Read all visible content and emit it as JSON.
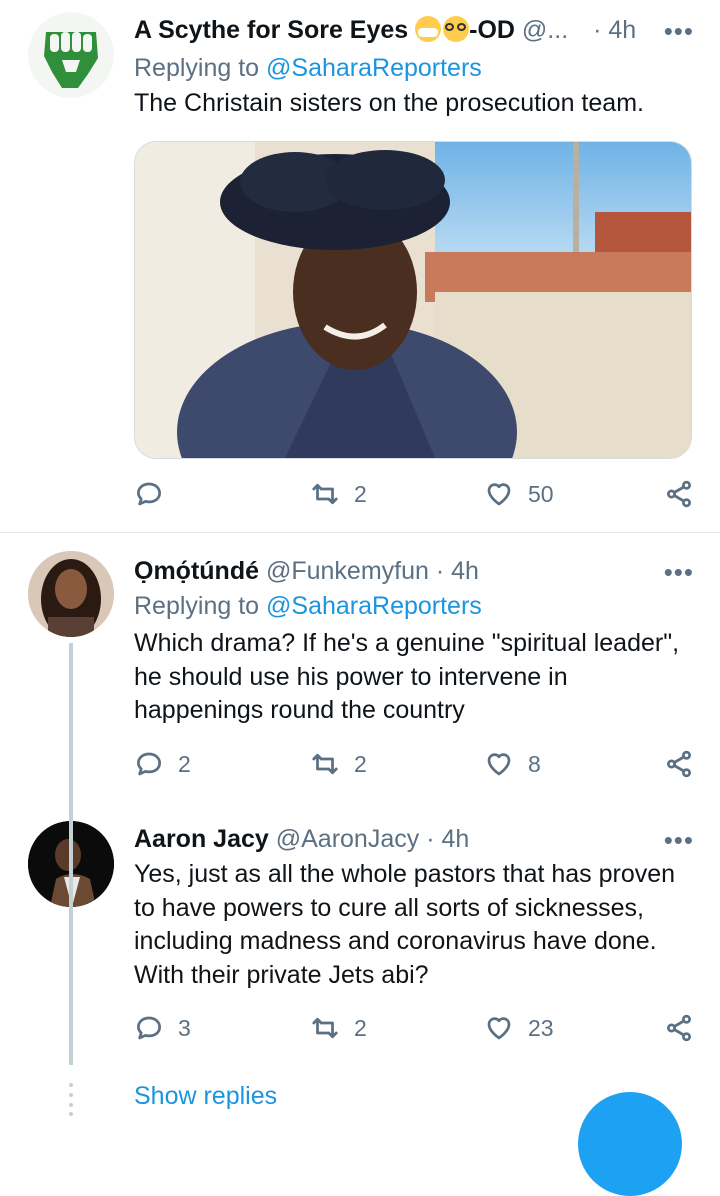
{
  "tweets": [
    {
      "name": "A Scythe for Sore Eyes",
      "name_suffix": "-OD",
      "handle": "@...",
      "separator": "·",
      "time": "4h",
      "more": "•••",
      "replying_prefix": "Replying to",
      "replying_to": "@SaharaReporters",
      "text": "The Christain sisters on the prosecution team.",
      "avatar_icon": "raised-fist-avatar",
      "has_media": true,
      "stats": {
        "replies": "",
        "retweets": "2",
        "likes": "50"
      }
    },
    {
      "name": "Ọmọ́túndé",
      "handle": "@Funkemyfun",
      "separator": "·",
      "time": "4h",
      "more": "•••",
      "replying_prefix": "Replying to",
      "replying_to": "@SaharaReporters",
      "text": "Which drama? If he's a genuine \"spiritual leader\", he should use his power to intervene in happenings round the country",
      "avatar_icon": "woman-avatar",
      "stats": {
        "replies": "2",
        "retweets": "2",
        "likes": "8"
      }
    },
    {
      "name": "Aaron Jacy",
      "handle": "@AaronJacy",
      "separator": "·",
      "time": "4h",
      "more": "•••",
      "text": "Yes, just as all the whole pastors that has proven to have powers to cure all sorts of sicknesses, including madness and coronavirus have done. With their private Jets abi?",
      "avatar_icon": "man-avatar",
      "stats": {
        "replies": "3",
        "retweets": "2",
        "likes": "23"
      }
    }
  ],
  "show_replies": "Show replies",
  "colors": {
    "link": "#1b95e0",
    "secondary": "#5b7083",
    "fab": "#1da1f2",
    "thread": "#c4cfd6"
  }
}
